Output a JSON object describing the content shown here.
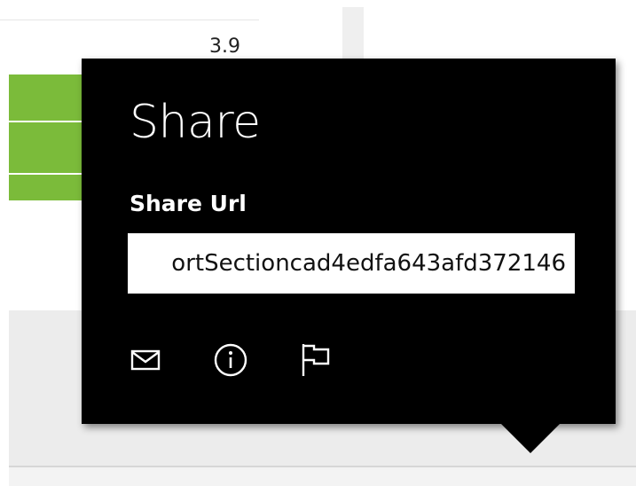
{
  "background": {
    "value_label": "3.9",
    "bar_color": "#7bbb3a"
  },
  "share_flyout": {
    "title": "Share",
    "field_label": "Share Url",
    "url_value": "ortSectioncad4edfa643afd372146",
    "actions": [
      {
        "icon": "mail-icon"
      },
      {
        "icon": "info-icon"
      },
      {
        "icon": "flag-icon"
      }
    ]
  }
}
